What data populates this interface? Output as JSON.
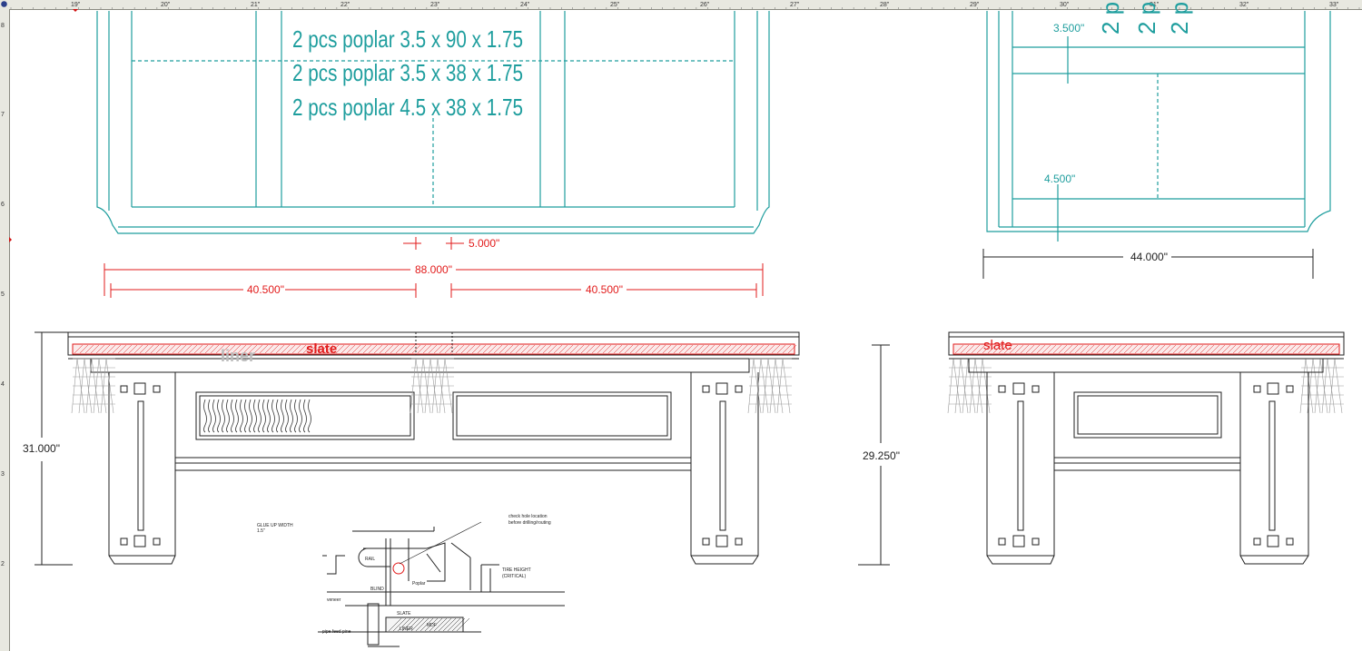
{
  "ruler": {
    "top_ticks": [
      "19\"",
      "20\"",
      "21\"",
      "22\"",
      "23\"",
      "24\"",
      "25\"",
      "26\"",
      "27\"",
      "28\"",
      "29\"",
      "30\"",
      "31\"",
      "32\"",
      "33\""
    ],
    "left_ticks": [
      "8",
      "7",
      "6",
      "5",
      "4",
      "3",
      "2"
    ]
  },
  "top_view_left": {
    "parts_list": [
      "2 pcs poplar 3.5 x 90 x 1.75",
      "2 pcs poplar 3.5 x 38 x 1.75",
      "2 pcs poplar 4.5 x 38 x 1.75"
    ]
  },
  "top_view_right": {
    "dim_a": "3.500\"",
    "dim_b": "4.500\"",
    "rotated_label": "2 p"
  },
  "dimensions": {
    "gap": "5.000\"",
    "overall_length": "88.000\"",
    "left_half": "40.500\"",
    "right_half": "40.500\"",
    "end_width": "44.000\"",
    "height_left": "31.000\"",
    "height_right": "29.250\""
  },
  "side_labels": {
    "slate": "slate",
    "liner": "liner",
    "slate_end": "slate"
  },
  "detail": {
    "glue_up_note": "GLUE UP WIDTH",
    "glue_up_sub": "1.5\"",
    "check_note_1": "check hole location",
    "check_note_2": "before drilling/routing",
    "tire_height": "TIRE HEIGHT",
    "tire_height_sub": "(CRITICAL)",
    "rail": "RAIL",
    "blind": "BLIND",
    "poplar": "Poplar",
    "veneer": "veneer",
    "slate": "SLATE",
    "liner": "LINER",
    "mdf": "MDF",
    "pipe": "pipe feed pine"
  },
  "colors": {
    "teal": "#1f9e9e",
    "red": "#e21b1b",
    "line": "#222222",
    "ruler_bg": "#e8e8e0"
  }
}
